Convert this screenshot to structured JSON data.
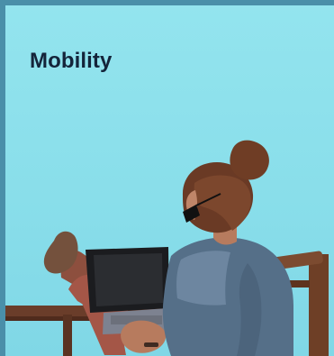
{
  "card": {
    "title": "Mobility"
  },
  "colors": {
    "frame": "#4a8fa9",
    "card_background": "#8ee0ec",
    "title": "#14243a"
  },
  "image": {
    "subject": "person-with-laptop-feet-up"
  }
}
